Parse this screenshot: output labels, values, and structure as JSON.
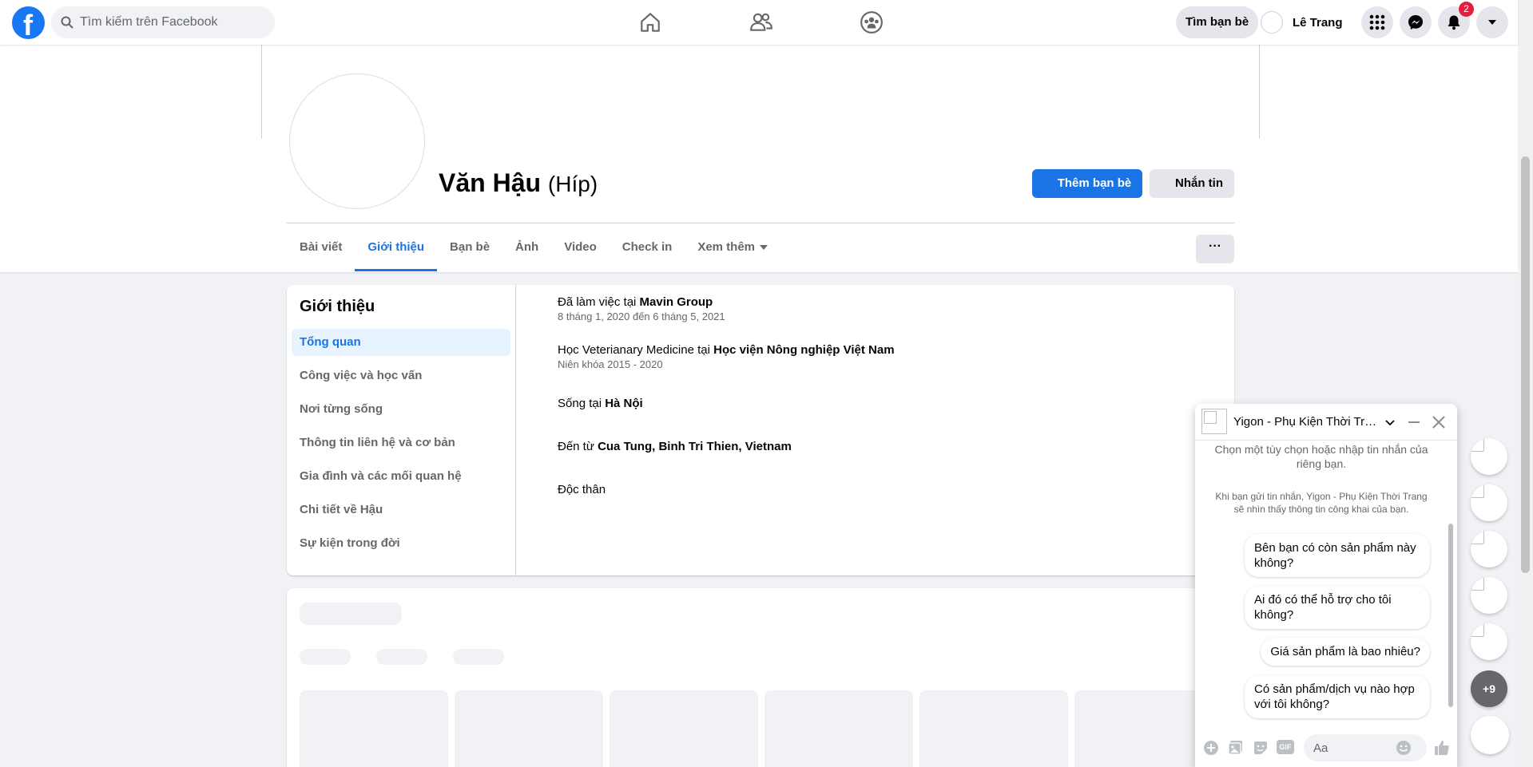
{
  "header": {
    "search_placeholder": "Tìm kiếm trên Facebook",
    "find_friends": "Tìm bạn bè",
    "user_name": "Lê Trang",
    "notification_count": "2"
  },
  "profile": {
    "name": "Văn Hậu",
    "nickname": "(Híp)",
    "add_friend_label": "Thêm bạn bè",
    "message_label": "Nhắn tin",
    "more_label": "···",
    "tabs": [
      "Bài viết",
      "Giới thiệu",
      "Bạn bè",
      "Ảnh",
      "Video",
      "Check in",
      "Xem thêm"
    ]
  },
  "about": {
    "title": "Giới thiệu",
    "menu": [
      "Tổng quan",
      "Công việc và học vấn",
      "Nơi từng sống",
      "Thông tin liên hệ và cơ bản",
      "Gia đình và các mối quan hệ",
      "Chi tiết về Hậu",
      "Sự kiện trong đời"
    ],
    "work": {
      "prefix": "Đã làm việc tại ",
      "place": "Mavin Group",
      "dates": "8 tháng 1, 2020 đến 6 tháng 5, 2021"
    },
    "education": {
      "prefix": "Học Veterianary Medicine tại ",
      "place": "Học viện Nông nghiệp Việt Nam",
      "dates": "Niên khóa 2015 - 2020"
    },
    "lives": {
      "prefix": "Sống tại ",
      "place": "Hà Nội"
    },
    "from": {
      "prefix": "Đến từ ",
      "place": "Cua Tung, Binh Tri Thien, Vietnam"
    },
    "relationship": "Độc thân"
  },
  "chat": {
    "title": "Yigon - Phụ Kiện Thời Trang",
    "intro": "Chọn một tùy chọn hoặc nhập tin nhắn của riêng bạn.",
    "notice": "Khi bạn gửi tin nhắn, Yigon - Phụ Kiện Thời Trang sẽ nhìn thấy thông tin công khai của bạn.",
    "quick_replies": [
      "Bên bạn có còn sản phẩm này không?",
      "Ai đó có thể hỗ trợ cho tôi không?",
      "Giá sản phẩm là bao nhiêu?",
      "Có sản phẩm/dịch vụ nào hợp với tôi không?"
    ],
    "input_placeholder": "Aa",
    "gif_label": "GIF"
  },
  "bubbles": {
    "more_label": "+9"
  }
}
